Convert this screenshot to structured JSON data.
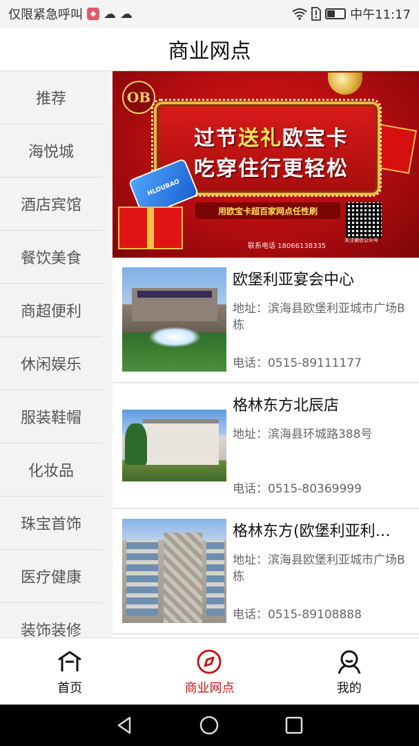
{
  "status_bar": {
    "left_text": "仅限紧急呼叫",
    "time": "中午11:17",
    "battery_level": 0.4
  },
  "header": {
    "title": "商业网点"
  },
  "sidebar": {
    "items": [
      {
        "label": "推荐"
      },
      {
        "label": "海悦城"
      },
      {
        "label": "酒店宾馆"
      },
      {
        "label": "餐饮美食"
      },
      {
        "label": "商超便利"
      },
      {
        "label": "休闲娱乐"
      },
      {
        "label": "服装鞋帽"
      },
      {
        "label": "化妆品"
      },
      {
        "label": "珠宝首饰"
      },
      {
        "label": "医疗健康"
      },
      {
        "label": "装饰装修"
      }
    ]
  },
  "banner": {
    "logo": "OB",
    "line1_a": "过节",
    "line1_b": "送礼",
    "line1_c": "欧宝卡",
    "line2": "吃穿住行更轻松",
    "card_text": "HLOUBAO",
    "ribbon": "用欧宝卡超百家网点任性刷",
    "phone": "联系电话 18066138335",
    "qr_caption": "关注微信公众号"
  },
  "stores": [
    {
      "name": "欧堡利亚宴会中心",
      "address": "地址：滨海县欧堡利亚城市广场B栋",
      "phone": "电话：0515-89111177"
    },
    {
      "name": "格林东方北辰店",
      "address": "地址：滨海县环城路388号",
      "phone": "电话：0515-80369999"
    },
    {
      "name": "格林东方(欧堡利亚利…",
      "address": "地址：滨海县欧堡利亚城市广场B栋",
      "phone": "电话：0515-89108888"
    }
  ],
  "tabs": [
    {
      "label": "首页",
      "icon": "home-icon"
    },
    {
      "label": "商业网点",
      "icon": "compass-icon"
    },
    {
      "label": "我的",
      "icon": "user-icon"
    }
  ],
  "colors": {
    "accent": "#c81515",
    "sidebar_bg": "#f3f3f3"
  }
}
